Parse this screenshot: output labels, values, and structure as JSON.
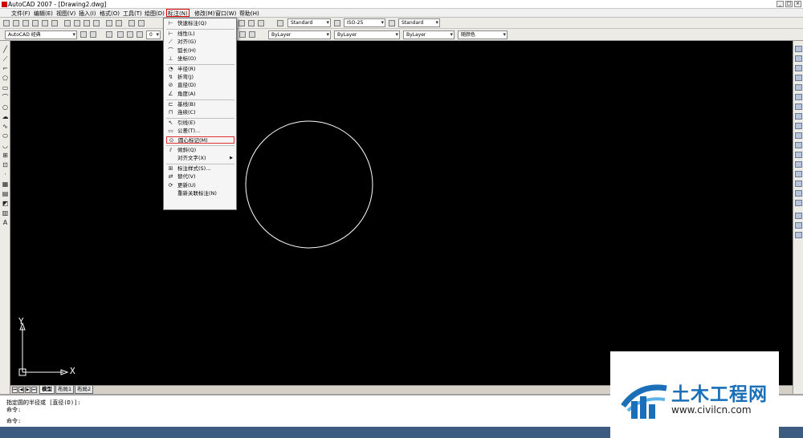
{
  "window": {
    "title": "AutoCAD 2007 - [Drawing2.dwg]",
    "minimize": "_",
    "maximize": "□",
    "close": "×"
  },
  "menubar": {
    "items": [
      "文件(F)",
      "编辑(E)",
      "视图(V)",
      "插入(I)",
      "格式(O)",
      "工具(T)",
      "绘图(D)",
      "标注(N)",
      "修改(M)",
      "窗口(W)",
      "帮助(H)"
    ],
    "selected_index": 7
  },
  "toolbar": {
    "text_style": "Standard",
    "dim_style": "ISO-25",
    "table_style": "Standard",
    "workspace": "AutoCAD 经典",
    "layer": "0",
    "color": "ByLayer",
    "linetype": "ByLayer",
    "lineweight": "ByLayer",
    "plot_style": "随颜色"
  },
  "dimension_menu": {
    "items": [
      {
        "label": "快速标注(Q)",
        "icon": "quick-dim-icon",
        "glyph": "⊢"
      },
      {
        "sep": true
      },
      {
        "label": "线性(L)",
        "icon": "linear-dim-icon",
        "glyph": "⊢"
      },
      {
        "label": "对齐(G)",
        "icon": "aligned-dim-icon",
        "glyph": "⟋"
      },
      {
        "label": "弧长(H)",
        "icon": "arc-length-icon",
        "glyph": "⌒"
      },
      {
        "label": "坐标(O)",
        "icon": "ordinate-icon",
        "glyph": "⊥"
      },
      {
        "sep": true
      },
      {
        "label": "半径(R)",
        "icon": "radius-icon",
        "glyph": "◔"
      },
      {
        "label": "折弯(J)",
        "icon": "jogged-icon",
        "glyph": "↯"
      },
      {
        "label": "直径(D)",
        "icon": "diameter-icon",
        "glyph": "⊘"
      },
      {
        "label": "角度(A)",
        "icon": "angle-icon",
        "glyph": "∠"
      },
      {
        "sep": true
      },
      {
        "label": "基线(B)",
        "icon": "baseline-icon",
        "glyph": "⊏"
      },
      {
        "label": "连续(C)",
        "icon": "continue-icon",
        "glyph": "⊓"
      },
      {
        "sep": true
      },
      {
        "label": "引线(E)",
        "icon": "leader-icon",
        "glyph": "↖"
      },
      {
        "label": "公差(T)...",
        "icon": "tolerance-icon",
        "glyph": "▭"
      },
      {
        "label": "圆心标记(M)",
        "icon": "center-mark-icon",
        "glyph": "⊙",
        "highlight": true
      },
      {
        "sep": true
      },
      {
        "label": "倾斜(Q)",
        "icon": "oblique-icon",
        "glyph": "⫽"
      },
      {
        "label": "对齐文字(X)",
        "icon": "",
        "glyph": "",
        "submenu": true
      },
      {
        "sep": true
      },
      {
        "label": "标注样式(S)...",
        "icon": "dim-style-icon",
        "glyph": "⊞"
      },
      {
        "label": "替代(V)",
        "icon": "override-icon",
        "glyph": "⇄"
      },
      {
        "label": "更新(U)",
        "icon": "update-icon",
        "glyph": "⟳"
      },
      {
        "label": "重新关联标注(N)",
        "icon": "",
        "glyph": ""
      }
    ]
  },
  "canvas": {
    "ucs_x": "X",
    "ucs_y": "Y"
  },
  "tabs": {
    "nav": [
      "⏮",
      "◀",
      "▶",
      "⏭"
    ],
    "items": [
      "模型",
      "布局1",
      "布局2"
    ],
    "active": 0
  },
  "command_line": {
    "line1": "指定圆的半径或 [直径(D)]:",
    "line2": "命令:",
    "line3": "命令:"
  },
  "watermark": {
    "name": "土木工程网",
    "url": "www.civilcn.com"
  },
  "colors": {
    "canvas": "#000000",
    "highlight": "#e03030",
    "logo_blue": "#1a6fb8"
  }
}
